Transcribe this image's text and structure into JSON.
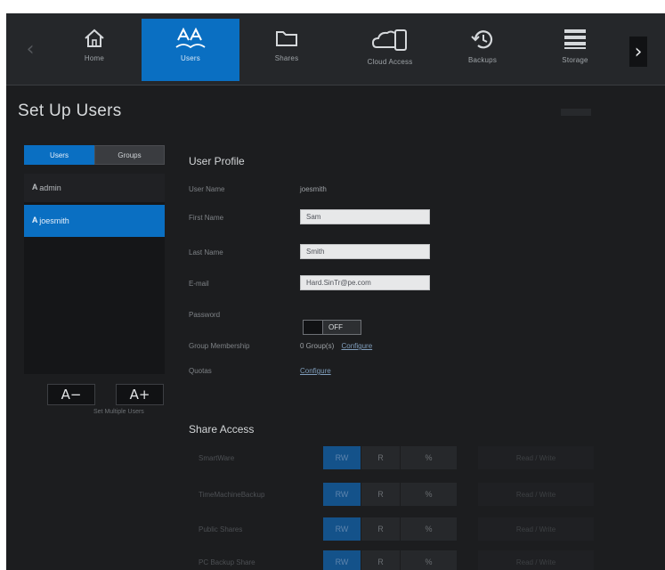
{
  "nav": {
    "items": [
      {
        "label": "Home",
        "icon": "home-icon",
        "active": false
      },
      {
        "label": "Users",
        "icon": "users-icon",
        "active": true
      },
      {
        "label": "Shares",
        "icon": "folder-icon",
        "active": false
      },
      {
        "label": "Cloud Access",
        "icon": "cloud-device-icon",
        "active": false
      },
      {
        "label": "Backups",
        "icon": "history-icon",
        "active": false
      },
      {
        "label": "Storage",
        "icon": "storage-icon",
        "active": false
      }
    ]
  },
  "page": {
    "title": "Set Up Users"
  },
  "sidebar": {
    "tabs": [
      {
        "label": "Users",
        "active": true
      },
      {
        "label": "Groups",
        "active": false
      }
    ],
    "users": [
      {
        "name": "admin",
        "selected": false
      },
      {
        "name": "joesmith",
        "selected": true
      }
    ],
    "remove_label": "A−",
    "add_label": "A+",
    "advanced_link": "Set Multiple Users"
  },
  "profile": {
    "title": "User Profile",
    "username_label": "User Name",
    "username_value": "joesmith",
    "first_name_label": "First Name",
    "first_name_value": "Sam",
    "last_name_label": "Last Name",
    "last_name_value": "Smith",
    "email_label": "E-mail",
    "email_value": "Hard.SinTr@pe.com",
    "password_label": "Password",
    "password_state": "OFF",
    "group_label": "Group Membership",
    "group_value": "0 Group(s)",
    "group_link": "Configure",
    "quota_label": "Quotas",
    "quota_link": "Configure"
  },
  "share_access": {
    "title": "Share Access",
    "rows": [
      {
        "name": "SmartWare",
        "permission": "Read / Write"
      },
      {
        "name": "TimeMachineBackup",
        "permission": "Read / Write"
      },
      {
        "name": "Public Shares",
        "permission": "Read / Write"
      },
      {
        "name": "PC Backup Share",
        "permission": "Read / Write"
      }
    ],
    "option_rw": "RW",
    "option_ro": "R",
    "option_na": "%"
  },
  "colors": {
    "accent": "#0a6fc2",
    "background": "#1c1d1f"
  }
}
